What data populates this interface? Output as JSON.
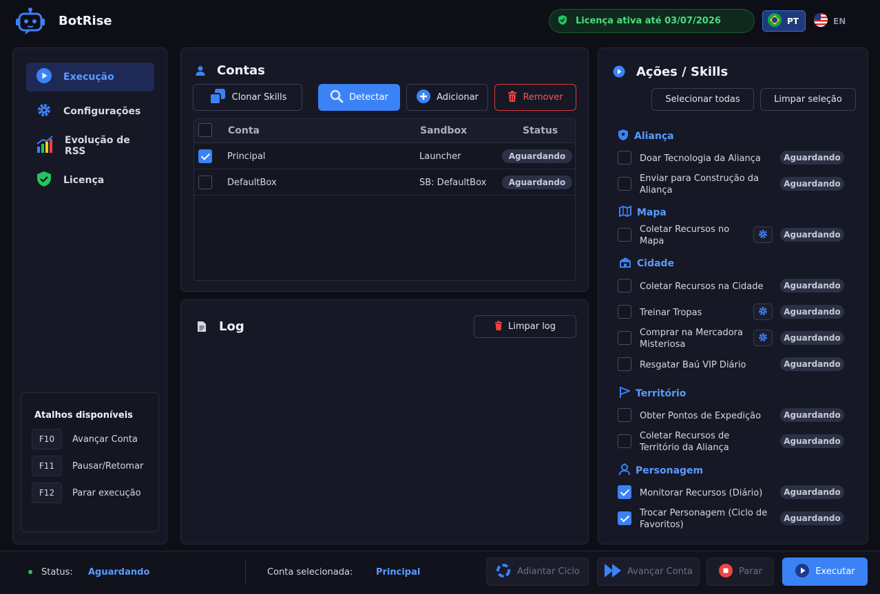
{
  "app": {
    "title": "BotRise"
  },
  "header": {
    "license": "Licença ativa até 03/07/2026",
    "lang_pt": "PT",
    "lang_en": "EN"
  },
  "sidebar": {
    "items": [
      {
        "label": "Execução",
        "icon": "play-icon",
        "active": true
      },
      {
        "label": "Configurações",
        "icon": "gear-icon"
      },
      {
        "label": "Evolução de RSS",
        "icon": "chart-icon"
      },
      {
        "label": "Licença",
        "icon": "shield-icon"
      }
    ],
    "shortcuts": {
      "title": "Atalhos disponíveis",
      "items": [
        {
          "key": "F10",
          "label": "Avançar Conta"
        },
        {
          "key": "F11",
          "label": "Pausar/Retomar"
        },
        {
          "key": "F12",
          "label": "Parar execução"
        }
      ]
    }
  },
  "accounts": {
    "title": "Contas",
    "buttons": {
      "clone": "Clonar Skills",
      "detect": "Detectar",
      "add": "Adicionar",
      "remove": "Remover"
    },
    "columns": {
      "account": "Conta",
      "sandbox": "Sandbox",
      "status": "Status"
    },
    "rows": [
      {
        "checked": true,
        "account": "Principal",
        "sandbox": "Launcher",
        "status": "Aguardando"
      },
      {
        "checked": false,
        "account": "DefaultBox",
        "sandbox": "SB: DefaultBox",
        "status": "Aguardando"
      }
    ]
  },
  "log": {
    "title": "Log",
    "clear": "Limpar log"
  },
  "skills": {
    "title": "Ações / Skills",
    "select_all": "Selecionar todas",
    "clear_selection": "Limpar seleção",
    "sections": [
      {
        "title": "Aliança",
        "items": [
          {
            "label": "Doar Tecnologia da Aliança",
            "status": "Aguardando"
          },
          {
            "label": "Enviar para Construção da Aliança",
            "status": "Aguardando"
          }
        ]
      },
      {
        "title": "Mapa",
        "items": [
          {
            "label": "Coletar Recursos no Mapa",
            "status": "Aguardando"
          }
        ]
      },
      {
        "title": "Cidade",
        "items": [
          {
            "label": "Coletar Recursos na Cidade",
            "status": "Aguardando"
          },
          {
            "label": "Treinar Tropas",
            "status": "Aguardando"
          },
          {
            "label": "Comprar na Mercadora Misteriosa",
            "status": "Aguardando"
          },
          {
            "label": "Resgatar Baú VIP Diário",
            "status": "Aguardando"
          }
        ]
      },
      {
        "title": "Território",
        "items": [
          {
            "label": "Obter Pontos de Expedição",
            "status": "Aguardando"
          },
          {
            "label": "Coletar Recursos de Território da Aliança",
            "status": "Aguardando"
          }
        ]
      },
      {
        "title": "Personagem",
        "items": [
          {
            "label": "Monitorar Recursos (Diário)",
            "status": "Aguardando",
            "checked": true
          },
          {
            "label": "Trocar Personagem (Ciclo de Favoritos)",
            "status": "Aguardando",
            "checked": true
          }
        ]
      }
    ]
  },
  "footer": {
    "status_label": "Status:",
    "status_value": "Aguardando",
    "selected_label": "Conta selecionada:",
    "selected_value": "Principal",
    "buttons": {
      "advance_cycle": "Adiantar Ciclo",
      "advance_account": "Avançar Conta",
      "stop": "Parar",
      "execute": "Executar"
    }
  },
  "colors": {
    "accent": "#3b82f6",
    "success": "#22c55e",
    "danger": "#ef4444",
    "background": "#0d0e16",
    "panel": "#161825"
  }
}
